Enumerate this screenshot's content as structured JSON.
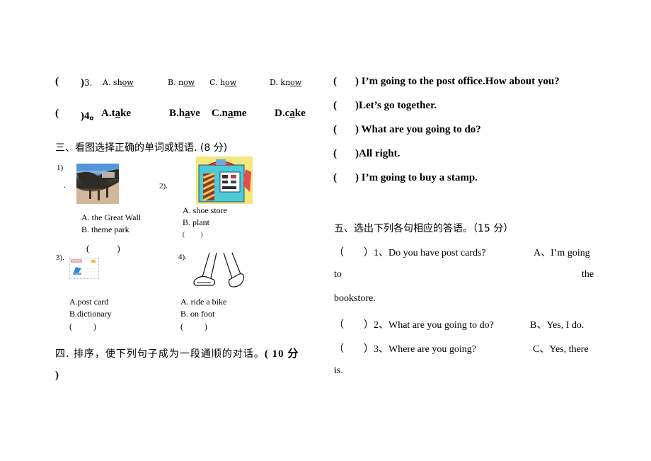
{
  "left": {
    "q3": {
      "bracket_open": "(",
      "bracket_close": ")3.",
      "options": [
        {
          "pre": "A. sh",
          "u": "ow",
          "post": ""
        },
        {
          "pre": "B. n",
          "u": "ow",
          "post": ""
        },
        {
          "pre": "C. h",
          "u": "ow",
          "post": ""
        },
        {
          "pre": "D. kn",
          "u": "ow",
          "post": ""
        }
      ]
    },
    "q4": {
      "bracket_open": "(",
      "bracket_close": ")4。",
      "options": [
        {
          "pre": "A.t",
          "u": "a",
          "post": "ke"
        },
        {
          "pre": "B.h",
          "u": "a",
          "post": "ve"
        },
        {
          "pre": "C.n",
          "u": "a",
          "post": "me"
        },
        {
          "pre": "D.c",
          "u": "a",
          "post": "ke"
        }
      ]
    },
    "section3": {
      "title": "三、看图选择正确的单词或短语. (8 分)",
      "items": [
        {
          "num": "1)",
          "dot": ".",
          "image": "great-wall-photo",
          "a": "A. the Great Wall",
          "b": "B. theme park",
          "answer": "(            )"
        },
        {
          "num": "2).",
          "image": "shoe-store-illustration",
          "a": "A. shoe store",
          "b": "B. plant",
          "answer": "(          )"
        },
        {
          "num": "3).",
          "image": "post-card-illustration",
          "a": "A.post card",
          "b": "B.dictionary",
          "answer": "(          )"
        },
        {
          "num": "4).",
          "image": "walking-feet-illustration",
          "a": "A. ride a bike",
          "b": "B. on foot",
          "answer": "(          )"
        }
      ]
    },
    "section4": {
      "title": "四. 排序，使下列句子成为一段通顺的对话。",
      "score": "( 10 分",
      "score_close": ")"
    }
  },
  "right": {
    "dialogue": [
      {
        "open": "(",
        "close": ")",
        "text": " I’m going to the post office.How about you?"
      },
      {
        "open": "(",
        "close": ")",
        "text": "Let’s go together."
      },
      {
        "open": "(",
        "close": ")",
        "text": " What are you going to do?"
      },
      {
        "open": "(",
        "close": ")",
        "text": "All right."
      },
      {
        "open": "(",
        "close": ")",
        "text": " I’m going to buy a stamp."
      }
    ],
    "section5": {
      "title": "五、选出下列各句相应的答语。（15 分）",
      "rows": [
        {
          "q": "（        ）1、Do you have post cards?",
          "a": "A、I’m going"
        },
        {
          "wrap_left": "to",
          "wrap_right": "the"
        },
        {
          "wrap_left": "bookstore."
        },
        {
          "q": "（        ）2、What are you going to do?",
          "a": "B、Yes, I do."
        },
        {
          "q": "（        ）3、Where are you going?",
          "a": "C、Yes, there"
        },
        {
          "wrap_left": "is."
        }
      ]
    }
  }
}
